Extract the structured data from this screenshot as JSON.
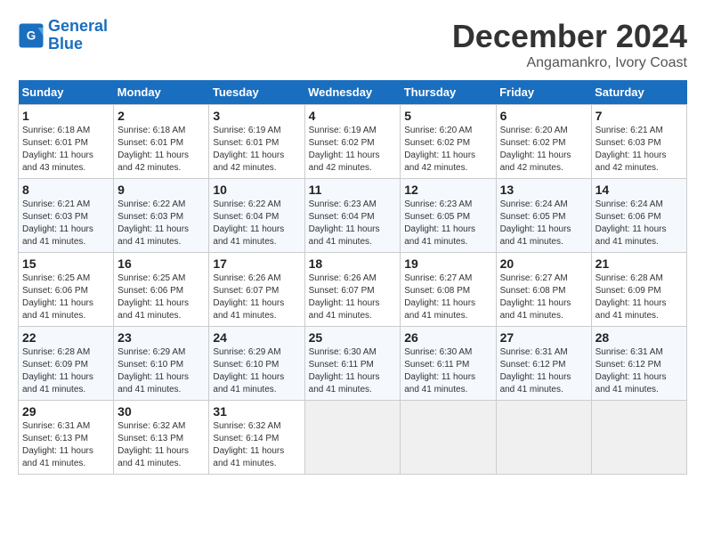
{
  "logo": {
    "line1": "General",
    "line2": "Blue"
  },
  "title": "December 2024",
  "subtitle": "Angamankro, Ivory Coast",
  "header": {
    "days": [
      "Sunday",
      "Monday",
      "Tuesday",
      "Wednesday",
      "Thursday",
      "Friday",
      "Saturday"
    ]
  },
  "weeks": [
    [
      {
        "day": "1",
        "info": "Sunrise: 6:18 AM\nSunset: 6:01 PM\nDaylight: 11 hours\nand 43 minutes."
      },
      {
        "day": "2",
        "info": "Sunrise: 6:18 AM\nSunset: 6:01 PM\nDaylight: 11 hours\nand 42 minutes."
      },
      {
        "day": "3",
        "info": "Sunrise: 6:19 AM\nSunset: 6:01 PM\nDaylight: 11 hours\nand 42 minutes."
      },
      {
        "day": "4",
        "info": "Sunrise: 6:19 AM\nSunset: 6:02 PM\nDaylight: 11 hours\nand 42 minutes."
      },
      {
        "day": "5",
        "info": "Sunrise: 6:20 AM\nSunset: 6:02 PM\nDaylight: 11 hours\nand 42 minutes."
      },
      {
        "day": "6",
        "info": "Sunrise: 6:20 AM\nSunset: 6:02 PM\nDaylight: 11 hours\nand 42 minutes."
      },
      {
        "day": "7",
        "info": "Sunrise: 6:21 AM\nSunset: 6:03 PM\nDaylight: 11 hours\nand 42 minutes."
      }
    ],
    [
      {
        "day": "8",
        "info": "Sunrise: 6:21 AM\nSunset: 6:03 PM\nDaylight: 11 hours\nand 41 minutes."
      },
      {
        "day": "9",
        "info": "Sunrise: 6:22 AM\nSunset: 6:03 PM\nDaylight: 11 hours\nand 41 minutes."
      },
      {
        "day": "10",
        "info": "Sunrise: 6:22 AM\nSunset: 6:04 PM\nDaylight: 11 hours\nand 41 minutes."
      },
      {
        "day": "11",
        "info": "Sunrise: 6:23 AM\nSunset: 6:04 PM\nDaylight: 11 hours\nand 41 minutes."
      },
      {
        "day": "12",
        "info": "Sunrise: 6:23 AM\nSunset: 6:05 PM\nDaylight: 11 hours\nand 41 minutes."
      },
      {
        "day": "13",
        "info": "Sunrise: 6:24 AM\nSunset: 6:05 PM\nDaylight: 11 hours\nand 41 minutes."
      },
      {
        "day": "14",
        "info": "Sunrise: 6:24 AM\nSunset: 6:06 PM\nDaylight: 11 hours\nand 41 minutes."
      }
    ],
    [
      {
        "day": "15",
        "info": "Sunrise: 6:25 AM\nSunset: 6:06 PM\nDaylight: 11 hours\nand 41 minutes."
      },
      {
        "day": "16",
        "info": "Sunrise: 6:25 AM\nSunset: 6:06 PM\nDaylight: 11 hours\nand 41 minutes."
      },
      {
        "day": "17",
        "info": "Sunrise: 6:26 AM\nSunset: 6:07 PM\nDaylight: 11 hours\nand 41 minutes."
      },
      {
        "day": "18",
        "info": "Sunrise: 6:26 AM\nSunset: 6:07 PM\nDaylight: 11 hours\nand 41 minutes."
      },
      {
        "day": "19",
        "info": "Sunrise: 6:27 AM\nSunset: 6:08 PM\nDaylight: 11 hours\nand 41 minutes."
      },
      {
        "day": "20",
        "info": "Sunrise: 6:27 AM\nSunset: 6:08 PM\nDaylight: 11 hours\nand 41 minutes."
      },
      {
        "day": "21",
        "info": "Sunrise: 6:28 AM\nSunset: 6:09 PM\nDaylight: 11 hours\nand 41 minutes."
      }
    ],
    [
      {
        "day": "22",
        "info": "Sunrise: 6:28 AM\nSunset: 6:09 PM\nDaylight: 11 hours\nand 41 minutes."
      },
      {
        "day": "23",
        "info": "Sunrise: 6:29 AM\nSunset: 6:10 PM\nDaylight: 11 hours\nand 41 minutes."
      },
      {
        "day": "24",
        "info": "Sunrise: 6:29 AM\nSunset: 6:10 PM\nDaylight: 11 hours\nand 41 minutes."
      },
      {
        "day": "25",
        "info": "Sunrise: 6:30 AM\nSunset: 6:11 PM\nDaylight: 11 hours\nand 41 minutes."
      },
      {
        "day": "26",
        "info": "Sunrise: 6:30 AM\nSunset: 6:11 PM\nDaylight: 11 hours\nand 41 minutes."
      },
      {
        "day": "27",
        "info": "Sunrise: 6:31 AM\nSunset: 6:12 PM\nDaylight: 11 hours\nand 41 minutes."
      },
      {
        "day": "28",
        "info": "Sunrise: 6:31 AM\nSunset: 6:12 PM\nDaylight: 11 hours\nand 41 minutes."
      }
    ],
    [
      {
        "day": "29",
        "info": "Sunrise: 6:31 AM\nSunset: 6:13 PM\nDaylight: 11 hours\nand 41 minutes."
      },
      {
        "day": "30",
        "info": "Sunrise: 6:32 AM\nSunset: 6:13 PM\nDaylight: 11 hours\nand 41 minutes."
      },
      {
        "day": "31",
        "info": "Sunrise: 6:32 AM\nSunset: 6:14 PM\nDaylight: 11 hours\nand 41 minutes."
      },
      null,
      null,
      null,
      null
    ]
  ]
}
